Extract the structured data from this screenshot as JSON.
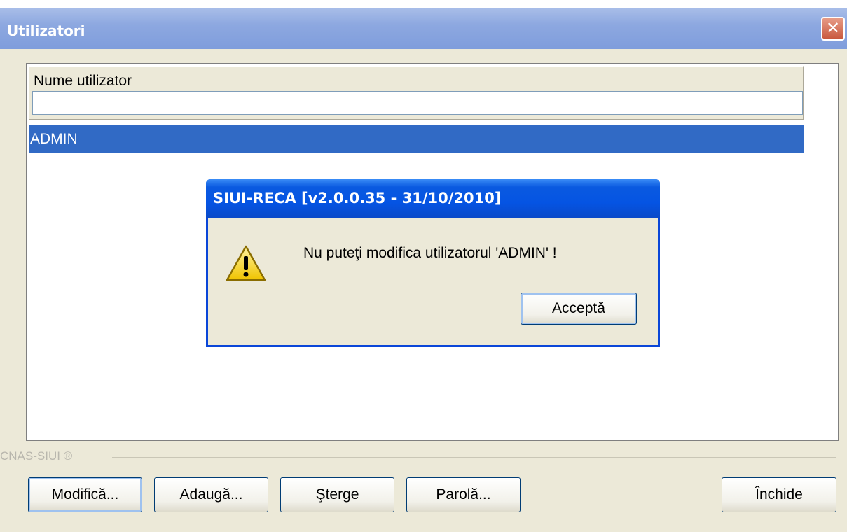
{
  "window": {
    "title": "Utilizatori",
    "close_glyph": "✕"
  },
  "list": {
    "column_header": "Nume utilizator",
    "filter_value": "",
    "rows": [
      "ADMIN"
    ]
  },
  "footer": {
    "brand": "CNAS-SIUI ®"
  },
  "buttons": {
    "modify": "Modifică...",
    "add": "Adaugă...",
    "delete": "Şterge",
    "password": "Parolă...",
    "close": "Închide"
  },
  "dialog": {
    "title": "SIUI-RECA [v2.0.0.35 - 31/10/2010]",
    "message": "Nu puteţi modifica utilizatorul 'ADMIN' !",
    "ok_label": "Acceptă",
    "icon": "warning-icon"
  },
  "colors": {
    "selection": "#316ac5",
    "dialog_title": "#0554e3",
    "window_title": "#8da8e0",
    "face": "#ece9d8"
  }
}
